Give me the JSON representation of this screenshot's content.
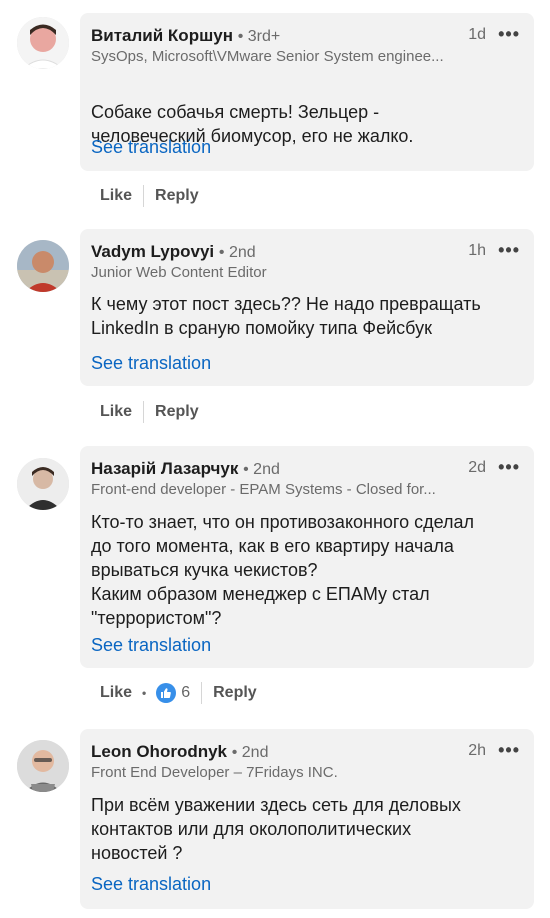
{
  "comments": [
    {
      "name": "Виталий Коршун",
      "degree": "• 3rd+",
      "time": "1d",
      "headline": "SysOps, Microsoft\\VMware Senior System enginee...",
      "text": "Собаке собачья смерть! Зельцер -\nчеловеческий биомусор, его не жалко.",
      "translate": "See translation",
      "like": "Like",
      "reply": "Reply"
    },
    {
      "name": "Vadym Lypovyi",
      "degree": "• 2nd",
      "time": "1h",
      "headline": "Junior Web Content Editor",
      "text": "К чему этот пост здесь?? Не надо превращать\nLinkedIn в сраную помойку типа Фейсбук",
      "translate": "See translation",
      "like": "Like",
      "reply": "Reply"
    },
    {
      "name": "Назарій Лазарчук",
      "degree": "• 2nd",
      "time": "2d",
      "headline": "Front-end developer - EPAM Systems - Closed for...",
      "text": "Кто-то знает, что он противозаконного сделал\nдо того момента, как в его квартиру начала\nврываться кучка чекистов?\nКаким образом менеджер с ЕПАМу стал\n\"террористом\"?",
      "translate": "See translation",
      "like": "Like",
      "reactions": "6",
      "reply": "Reply"
    },
    {
      "name": "Leon Ohorodnyk",
      "degree": "• 2nd",
      "time": "2h",
      "headline": "Front End Developer – 7Fridays INC.",
      "text": "При всём уважении здесь сеть для деловых\nконтактов или для околополитических\nновостей ?",
      "translate": "See translation"
    }
  ],
  "ui": {
    "more_icon": "more-horizontal-icon",
    "like_icon": "thumbs-up-icon",
    "accent": "#0a66c2",
    "bubble_bg": "#f2f2f2"
  }
}
